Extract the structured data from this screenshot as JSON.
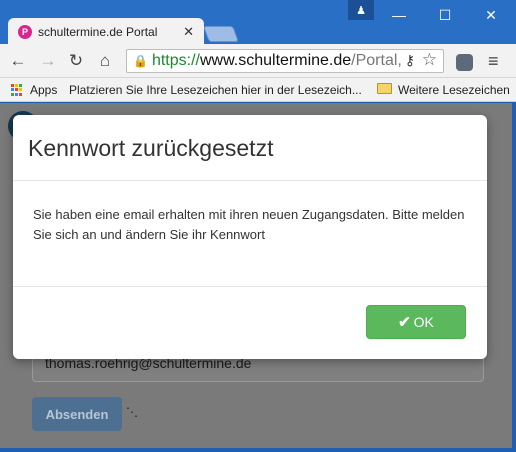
{
  "browser": {
    "tab_title": "schultermine.de Portal",
    "favicon_letter": "P",
    "url_scheme": "https://",
    "url_host": "www.schultermine.de",
    "url_path": "/Portal,",
    "bookmarks": {
      "apps_label": "Apps",
      "hint": "Platzieren Sie Ihre Lesezeichen hier in der Lesezeich...",
      "more_label": "Weitere Lesezeichen"
    },
    "colors": {
      "frame": "#2a6fc6",
      "secure": "#1a8a2e"
    }
  },
  "background_page": {
    "email_value": "thomas.roehrig@schultermine.de",
    "submit_label": "Absenden"
  },
  "modal": {
    "title": "Kennwort zurückgesetzt",
    "body": "Sie haben eine email erhalten mit ihren neuen Zugangsdaten. Bitte melden Sie sich an und ändern Sie ihr Kennwort",
    "ok_label": "OK",
    "ok_icon": "check-icon",
    "colors": {
      "ok": "#5cb85c"
    }
  }
}
